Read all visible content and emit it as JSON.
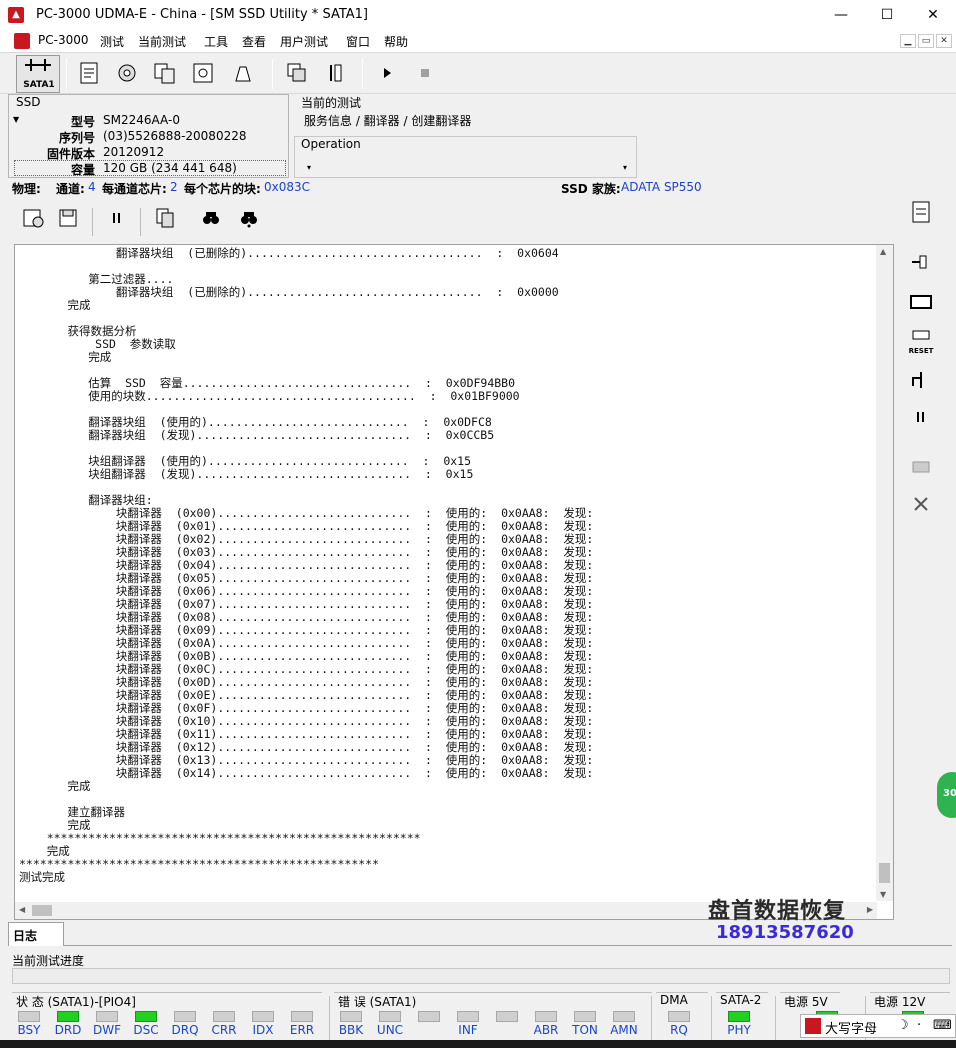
{
  "window": {
    "title": "PC-3000 UDMA-E - China - [SM SSD Utility * SATA1]",
    "min": "—",
    "max": "☐",
    "close": "✕"
  },
  "menu": [
    "PC-3000",
    "测试",
    "当前测试",
    "工具",
    "查看",
    "用户测试",
    "窗口",
    "帮助"
  ],
  "mdi": [
    "▁",
    "▭",
    "✕"
  ],
  "toolbar": {
    "sata_label": "SATA1"
  },
  "ssd": {
    "header": "SSD",
    "model_label": "型号",
    "model": "SM2246AA-0",
    "serial_label": "序列号",
    "serial": "(03)5526888-20080228",
    "fw_label": "固件版本",
    "fw": "20120912",
    "cap_label": "容量",
    "cap": "120 GB (234 441 648)"
  },
  "current_test": {
    "header": "当前的测试",
    "path": "服务信息 / 翻译器 / 创建翻译器"
  },
  "operation": {
    "header": "Operation",
    "left_arrow": "▾",
    "right_arrow": "▾"
  },
  "physical": {
    "label": "物理:",
    "channels_label": "通道:",
    "channels": "4",
    "chips_label": "每通道芯片:",
    "chips": "2",
    "blocks_label": "每个芯片的块:",
    "blocks": "0x083C",
    "family_label": "SSD 家族:",
    "family": "ADATA SP550"
  },
  "log": {
    "lines": [
      "              翻译器块组  (已删除的)..................................  :  0x0604",
      "",
      "          第二过滤器....",
      "              翻译器块组  (已删除的)..................................  :  0x0000",
      "       完成",
      "",
      "       获得数据分析",
      "           SSD  参数读取",
      "          完成",
      "",
      "          估算  SSD  容量.................................  :  0x0DF94BB0",
      "          使用的块数.......................................  :  0x01BF9000",
      "",
      "          翻译器块组  (使用的).............................  :  0x0DFC8",
      "          翻译器块组  (发现)...............................  :  0x0CCB5",
      "",
      "          块组翻译器  (使用的).............................  :  0x15",
      "          块组翻译器  (发现)...............................  :  0x15",
      "",
      "          翻译器块组:",
      "              块翻译器  (0x00)............................  :  使用的:  0x0AA8:  发现:",
      "              块翻译器  (0x01)............................  :  使用的:  0x0AA8:  发现:",
      "              块翻译器  (0x02)............................  :  使用的:  0x0AA8:  发现:",
      "              块翻译器  (0x03)............................  :  使用的:  0x0AA8:  发现:",
      "              块翻译器  (0x04)............................  :  使用的:  0x0AA8:  发现:",
      "              块翻译器  (0x05)............................  :  使用的:  0x0AA8:  发现:",
      "              块翻译器  (0x06)............................  :  使用的:  0x0AA8:  发现:",
      "              块翻译器  (0x07)............................  :  使用的:  0x0AA8:  发现:",
      "              块翻译器  (0x08)............................  :  使用的:  0x0AA8:  发现:",
      "              块翻译器  (0x09)............................  :  使用的:  0x0AA8:  发现:",
      "              块翻译器  (0x0A)............................  :  使用的:  0x0AA8:  发现:",
      "              块翻译器  (0x0B)............................  :  使用的:  0x0AA8:  发现:",
      "              块翻译器  (0x0C)............................  :  使用的:  0x0AA8:  发现:",
      "              块翻译器  (0x0D)............................  :  使用的:  0x0AA8:  发现:",
      "              块翻译器  (0x0E)............................  :  使用的:  0x0AA8:  发现:",
      "              块翻译器  (0x0F)............................  :  使用的:  0x0AA8:  发现:",
      "              块翻译器  (0x10)............................  :  使用的:  0x0AA8:  发现:",
      "              块翻译器  (0x11)............................  :  使用的:  0x0AA8:  发现:",
      "              块翻译器  (0x12)............................  :  使用的:  0x0AA8:  发现:",
      "              块翻译器  (0x13)............................  :  使用的:  0x0AA8:  发现:",
      "              块翻译器  (0x14)............................  :  使用的:  0x0AA8:  发现:",
      "       完成",
      "",
      "       建立翻译器",
      "       完成",
      "    ******************************************************",
      "    完成",
      "****************************************************",
      "测试完成"
    ]
  },
  "watermark": {
    "text": "盘首数据恢复",
    "phone": "18913587620"
  },
  "tabs": {
    "log": "日志"
  },
  "progress": {
    "label": "当前测试进度",
    "value": 0
  },
  "status_groups": [
    {
      "title": "状 态 (SATA1)-[PIO4]",
      "leds": [
        {
          "label": "BSY",
          "on": false
        },
        {
          "label": "DRD",
          "on": true
        },
        {
          "label": "DWF",
          "on": false
        },
        {
          "label": "DSC",
          "on": true
        },
        {
          "label": "DRQ",
          "on": false
        },
        {
          "label": "CRR",
          "on": false
        },
        {
          "label": "IDX",
          "on": false
        },
        {
          "label": "ERR",
          "on": false
        }
      ]
    },
    {
      "title": "错 误 (SATA1)",
      "leds": [
        {
          "label": "BBK",
          "on": false
        },
        {
          "label": "UNC",
          "on": false
        },
        {
          "label": "",
          "on": false
        },
        {
          "label": "INF",
          "on": false
        },
        {
          "label": "",
          "on": false
        },
        {
          "label": "ABR",
          "on": false
        },
        {
          "label": "TON",
          "on": false
        },
        {
          "label": "AMN",
          "on": false
        }
      ]
    },
    {
      "title": "DMA",
      "leds": [
        {
          "label": "RQ",
          "on": false
        }
      ]
    },
    {
      "title": "SATA-2",
      "leds": [
        {
          "label": "PHY",
          "on": true
        }
      ]
    },
    {
      "title": "电源 5V",
      "leds": [
        {
          "label": "",
          "on": true
        }
      ]
    },
    {
      "title": "电源 12V",
      "leds": [
        {
          "label": "",
          "on": true
        }
      ]
    }
  ],
  "ime": {
    "text": "大写字母",
    "moon": "☽",
    "dots": "·",
    "kbd": "⌨"
  },
  "badge": "30",
  "colors": {
    "accent_blue": "#1a44c8",
    "led_on": "#22d022",
    "led_off": "#cfcfcf",
    "brand_red": "#c8171e"
  }
}
